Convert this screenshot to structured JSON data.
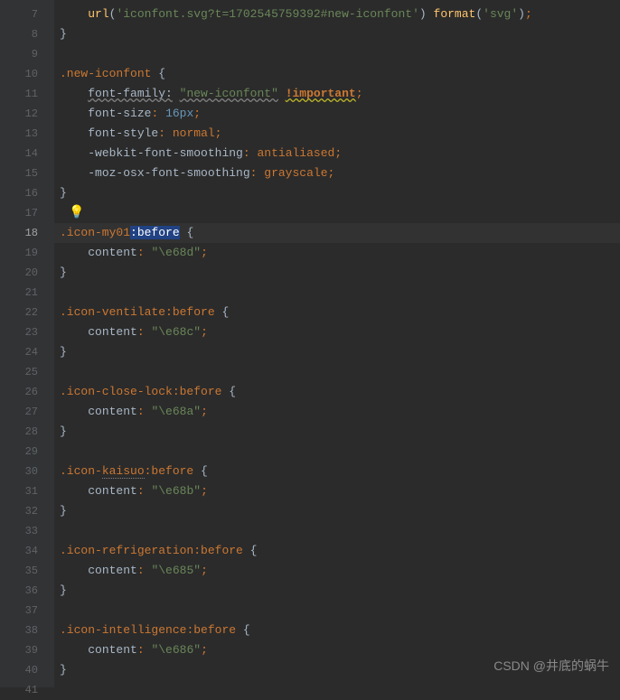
{
  "lines": {
    "start": 7,
    "end": 41,
    "active": 18
  },
  "code": {
    "l7": {
      "func": "url",
      "str1": "'iconfont.svg?t=1702545759392#new-iconfont'",
      "func2": "format",
      "str2": "'svg'"
    },
    "l8": "}",
    "l10_sel": ".new-iconfont",
    "l11_prop": "font-family:",
    "l11_val": "\"new-iconfont\"",
    "l11_imp": "!important",
    "l12_prop": "font-size",
    "l12_val": "16px",
    "l13_prop": "font-style",
    "l13_val": "normal",
    "l14_prop": "-webkit-font-smoothing",
    "l14_val": "antialiased",
    "l15_prop": "-moz-osx-font-smoothing",
    "l15_val": "grayscale",
    "l16": "}",
    "l18_sel": ".icon-my01",
    "l18_pseudo": ":before",
    "l19_prop": "content",
    "l19_val": "\"\\e68d\"",
    "l20": "}",
    "l22_sel": ".icon-ventilate",
    "l22_pseudo": ":before",
    "l23_prop": "content",
    "l23_val": "\"\\e68c\"",
    "l24": "}",
    "l26_sel": ".icon-close-lock",
    "l26_pseudo": ":before",
    "l27_prop": "content",
    "l27_val": "\"\\e68a\"",
    "l28": "}",
    "l30_sel": ".icon-",
    "l30_sel2": "kaisuo",
    "l30_pseudo": ":before",
    "l31_prop": "content",
    "l31_val": "\"\\e68b\"",
    "l32": "}",
    "l34_sel": ".icon-refrigeration",
    "l34_pseudo": ":before",
    "l35_prop": "content",
    "l35_val": "\"\\e685\"",
    "l36": "}",
    "l38_sel": ".icon-intelligence",
    "l38_pseudo": ":before",
    "l39_prop": "content",
    "l39_val": "\"\\e686\"",
    "l40": "}"
  },
  "bulb_line": 17,
  "watermark": "CSDN @井底的蜗牛"
}
